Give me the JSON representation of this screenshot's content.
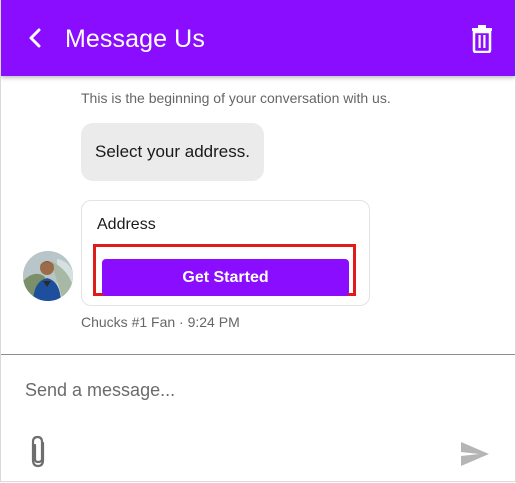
{
  "header": {
    "title": "Message Us",
    "back_icon": "chevron-left-icon",
    "delete_icon": "trash-icon",
    "background": "#8a0dff"
  },
  "conversation": {
    "intro": "This is the beginning of your conversation with us.",
    "message": "Select your address.",
    "card": {
      "title": "Address",
      "button_label": "Get Started",
      "button_color": "#8a0dff",
      "highlight_color": "#e01b1b"
    },
    "meta": "Chucks #1 Fan · 9:24 PM",
    "avatar_icon": "user-avatar"
  },
  "composer": {
    "placeholder": "Send a message...",
    "value": "",
    "attach_icon": "paperclip-icon",
    "send_icon": "send-icon"
  }
}
